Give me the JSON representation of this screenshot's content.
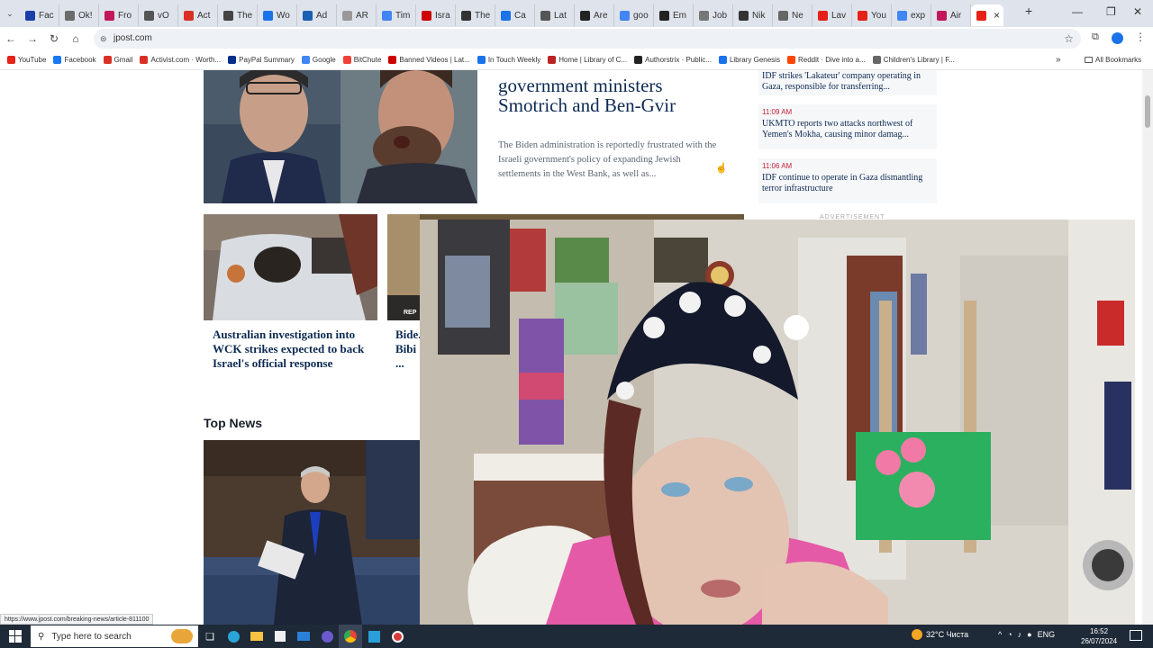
{
  "browser": {
    "tabs": [
      "Fac",
      "Ok!",
      "Fro",
      "vO",
      "Act",
      "The",
      "Wo",
      "Ad",
      "AR",
      "Tim",
      "Isra",
      "The",
      "Ca",
      "Lat",
      "Are",
      "goo",
      "Em",
      "Job",
      "Nik",
      "Ne",
      "Lav",
      "You",
      "exp",
      "Air",
      ""
    ],
    "active_tab_close": "×",
    "new_tab": "+",
    "url": "jpost.com",
    "bookmarks": [
      {
        "label": "YouTube",
        "color": "#e62117"
      },
      {
        "label": "Facebook",
        "color": "#1877f2"
      },
      {
        "label": "Gmail",
        "color": "#d93025"
      },
      {
        "label": "Activist.com · Worth...",
        "color": "#d93025"
      },
      {
        "label": "PayPal Summary",
        "color": "#003087"
      },
      {
        "label": "Google",
        "color": "#4285f4"
      },
      {
        "label": "BitChute",
        "color": "#ef4137"
      },
      {
        "label": "Banned Videos | Lat...",
        "color": "#c00"
      },
      {
        "label": "In Touch Weekly",
        "color": "#1a73e8"
      },
      {
        "label": "Home | Library of C...",
        "color": "#b22"
      },
      {
        "label": "Authorstrix · Public...",
        "color": "#222"
      },
      {
        "label": "Library Genesis",
        "color": "#1a73e8"
      },
      {
        "label": "Reddit · Dive into a...",
        "color": "#ff4500"
      },
      {
        "label": "Children's Library | F...",
        "color": "#666"
      }
    ],
    "all_bookmarks": "All Bookmarks",
    "status_url": "https://www.jpost.com/breaking-news/article-811100"
  },
  "article": {
    "headline_partial": "government ministers Smotrich and Ben-Gvir",
    "summary": "The Biden administration is reportedly frustrated with the Israeli government's policy of expanding Jewish settlements in the West Bank, as well as..."
  },
  "ticker": [
    {
      "time": "",
      "text": "IDF strikes 'Lakateur' company operating in Gaza, responsible for transferring..."
    },
    {
      "time": "11:09 AM",
      "text": "UKMTO reports two attacks northwest of Yemen's Mokha, causing minor damag..."
    },
    {
      "time": "11:06 AM",
      "text": "IDF continue to operate in Gaza dismantling terror infrastructure"
    }
  ],
  "advertisement": "ADVERTISEMENT",
  "cards": [
    {
      "title": "Australian investigation into WCK strikes expected to back Israel's official response"
    },
    {
      "title": "Bide... Bibi ... advi..."
    }
  ],
  "card2_badge": "REP",
  "top_news": "Top News",
  "taskbar": {
    "search_placeholder": "Type here to search",
    "weather": "32°C Чиста",
    "lang": "ENG",
    "time": "16:52",
    "date": "26/07/2024"
  }
}
